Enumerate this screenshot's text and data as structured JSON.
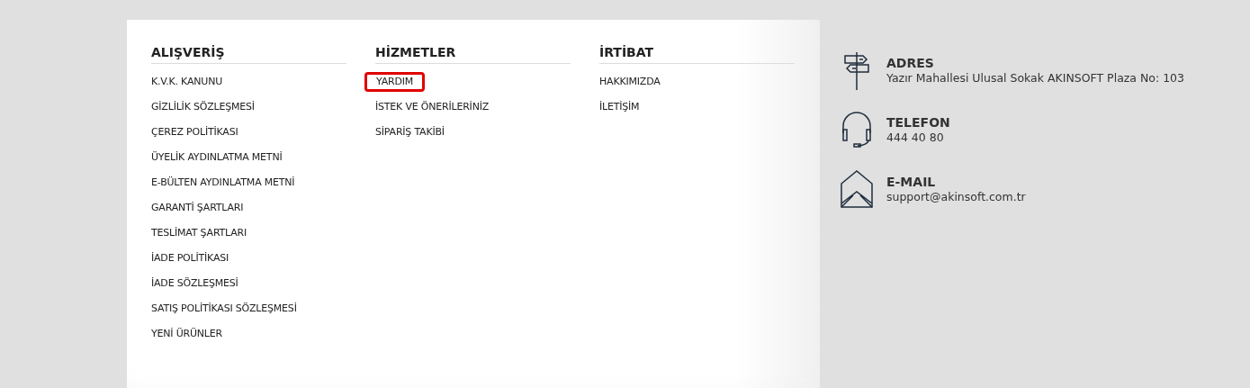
{
  "columns": [
    {
      "title": "ALIŞVERİŞ",
      "links": [
        {
          "label": "K.V.K. KANUNU",
          "highlighted": false
        },
        {
          "label": "GİZLİLİK SÖZLEŞMESİ",
          "highlighted": false
        },
        {
          "label": "ÇEREZ POLİTİKASI",
          "highlighted": false
        },
        {
          "label": "ÜYELİK AYDINLATMA METNİ",
          "highlighted": false
        },
        {
          "label": "E-BÜLTEN AYDINLATMA METNİ",
          "highlighted": false
        },
        {
          "label": "GARANTİ ŞARTLARI",
          "highlighted": false
        },
        {
          "label": "TESLİMAT ŞARTLARI",
          "highlighted": false
        },
        {
          "label": "İADE POLİTİKASI",
          "highlighted": false
        },
        {
          "label": "İADE SÖZLEŞMESİ",
          "highlighted": false
        },
        {
          "label": "SATIŞ POLİTİKASI SÖZLEŞMESİ",
          "highlighted": false
        },
        {
          "label": "YENİ ÜRÜNLER",
          "highlighted": false
        }
      ]
    },
    {
      "title": "HİZMETLER",
      "links": [
        {
          "label": "YARDIM",
          "highlighted": true
        },
        {
          "label": "İSTEK VE ÖNERİLERİNİZ",
          "highlighted": false
        },
        {
          "label": "SİPARİŞ TAKİBİ",
          "highlighted": false
        }
      ]
    },
    {
      "title": "İRTİBAT",
      "links": [
        {
          "label": "HAKKIMIZDA",
          "highlighted": false
        },
        {
          "label": "İLETİŞİM",
          "highlighted": false
        }
      ]
    }
  ],
  "contact": [
    {
      "kind": "address",
      "title": "ADRES",
      "value": "Yazır Mahallesi Ulusal Sokak AKINSOFT Plaza No: 103"
    },
    {
      "kind": "phone",
      "title": "TELEFON",
      "value": "444 40 80"
    },
    {
      "kind": "email",
      "title": "E-MAIL",
      "value": "support@akinsoft.com.tr"
    }
  ]
}
